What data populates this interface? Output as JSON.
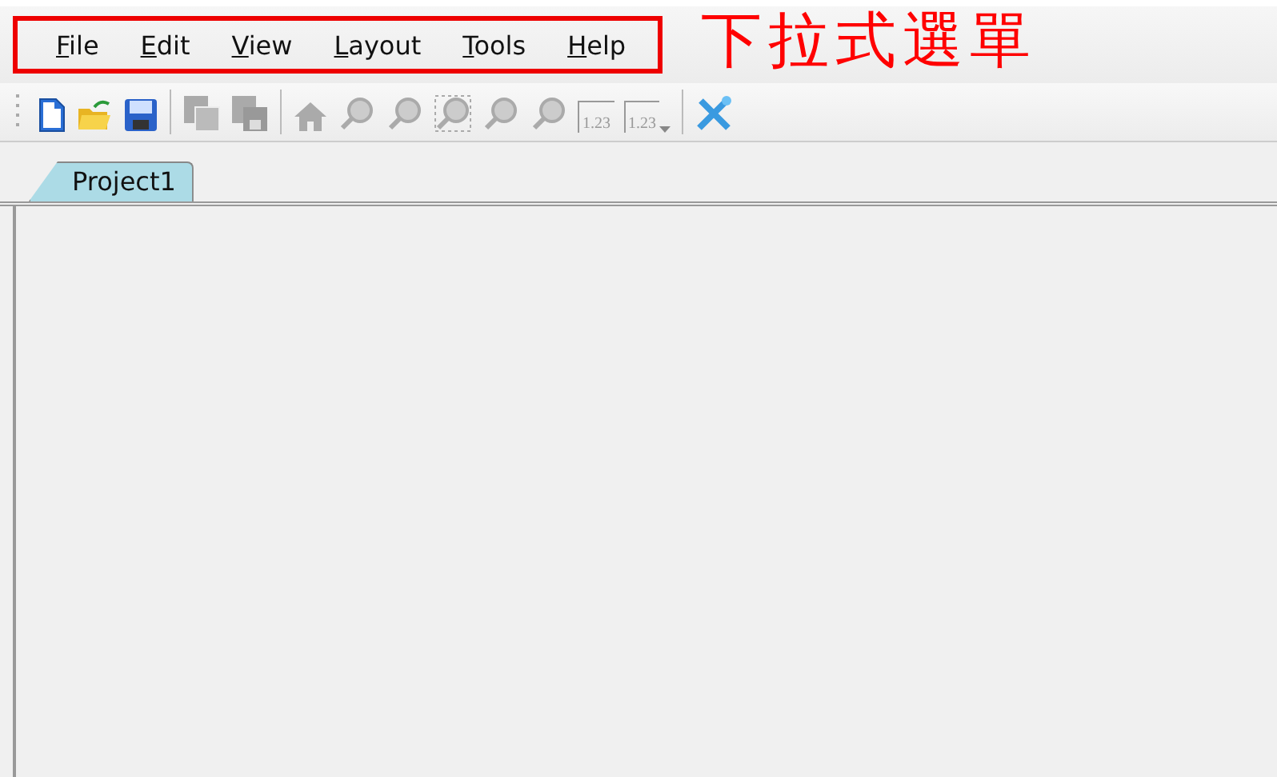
{
  "menu": [
    {
      "label": "File"
    },
    {
      "label": "Edit"
    },
    {
      "label": "View"
    },
    {
      "label": "Layout"
    },
    {
      "label": "Tools"
    },
    {
      "label": "Help"
    }
  ],
  "annotation": {
    "text": "下拉式選單"
  },
  "toolbar": [
    {
      "kind": "new",
      "disabled": false
    },
    {
      "kind": "open",
      "disabled": false
    },
    {
      "kind": "save",
      "disabled": false
    },
    {
      "kind": "separator"
    },
    {
      "kind": "copy",
      "disabled": true
    },
    {
      "kind": "save-copy",
      "disabled": true
    },
    {
      "kind": "separator"
    },
    {
      "kind": "home",
      "disabled": true
    },
    {
      "kind": "zoom",
      "disabled": true
    },
    {
      "kind": "zoom",
      "disabled": true
    },
    {
      "kind": "zoom-box",
      "disabled": true
    },
    {
      "kind": "zoom",
      "disabled": true
    },
    {
      "kind": "zoom",
      "disabled": true
    },
    {
      "kind": "number",
      "label": "1.23",
      "disabled": true
    },
    {
      "kind": "number-menu",
      "label": "1.23",
      "disabled": true
    },
    {
      "kind": "separator"
    },
    {
      "kind": "tools",
      "disabled": false
    }
  ],
  "tabs": [
    {
      "label": "Project1",
      "selected": true
    }
  ]
}
